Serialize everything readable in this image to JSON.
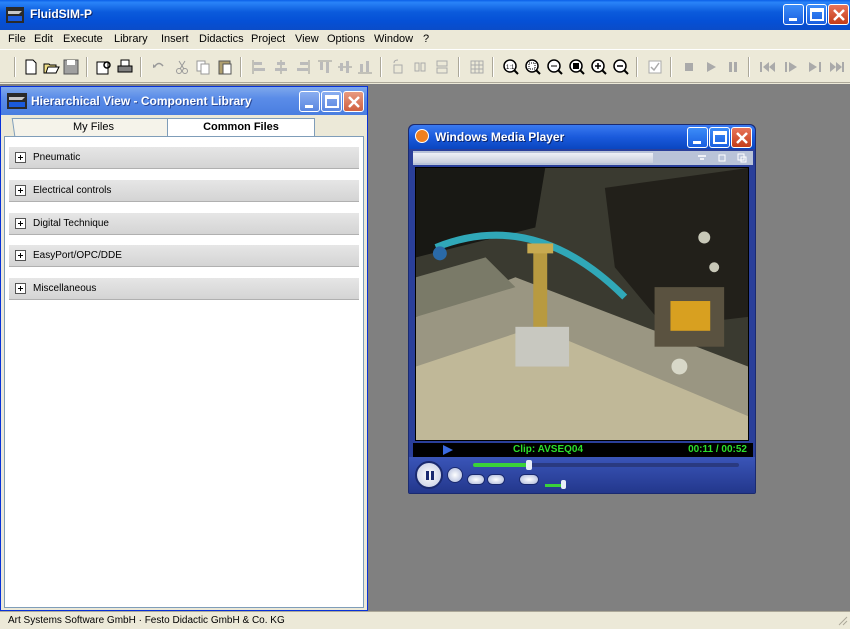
{
  "app": {
    "title": "FluidSIM-P"
  },
  "menu": {
    "items": [
      "File",
      "Edit",
      "Execute",
      "Library",
      "Insert",
      "Didactics",
      "Project",
      "View",
      "Options",
      "Window",
      "?"
    ]
  },
  "toolbar": {
    "icons": [
      "new-icon",
      "open-icon",
      "save-icon",
      "print-preview-icon",
      "print-icon",
      "undo-icon",
      "cut-icon",
      "copy-icon",
      "paste-icon",
      "align-left-icon",
      "align-center-icon",
      "align-right-icon",
      "align-top-icon",
      "align-middle-icon",
      "align-bottom-icon",
      "rotate-left-icon",
      "rotate-right-icon",
      "mirror-icon",
      "grid-icon",
      "zoom-1to1-icon",
      "zoom-window-icon",
      "zoom-fit-icon",
      "zoom-previous-icon",
      "zoom-in-icon",
      "zoom-out-icon",
      "check-icon",
      "stop-icon",
      "play-icon",
      "pause-icon",
      "reset-icon",
      "step-icon",
      "step-forward-icon",
      "fast-forward-icon"
    ]
  },
  "library_window": {
    "title": "Hierarchical View - Component Library",
    "tabs": [
      {
        "label": "My Files",
        "active": false
      },
      {
        "label": "Common Files",
        "active": true
      }
    ],
    "categories": [
      {
        "label": "Pneumatic"
      },
      {
        "label": "Electrical controls"
      },
      {
        "label": "Digital Technique"
      },
      {
        "label": "EasyPort/OPC/DDE"
      },
      {
        "label": "Miscellaneous"
      }
    ]
  },
  "media_player": {
    "title": "Windows Media Player",
    "clip_label": "Clip: AVSEQ04",
    "time": "00:11 / 00:52",
    "progress": 0.21,
    "volume": 0.6
  },
  "status_bar": {
    "text": "Art Systems Software GmbH · Festo Didactic GmbH & Co. KG"
  },
  "colors": {
    "titlebar": "#0550d6",
    "mdi_background": "#808080",
    "clip_text": "#2ce02c"
  }
}
